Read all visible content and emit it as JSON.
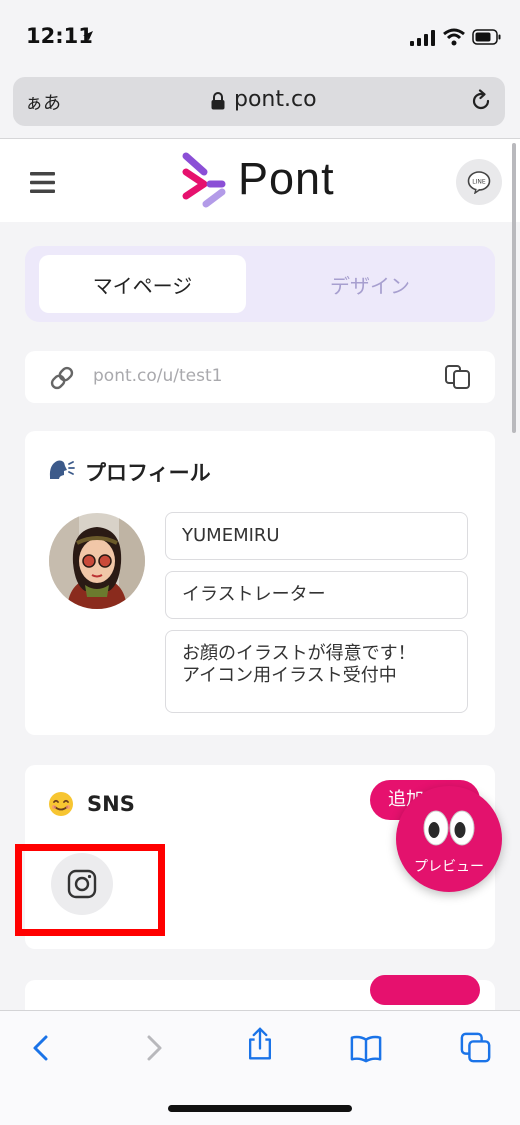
{
  "status_bar": {
    "time": "12:11"
  },
  "browser": {
    "text_size_label": "ぁあ",
    "url": "pont.co"
  },
  "header": {
    "logo_text": "Pont",
    "line_badge": "LINE"
  },
  "tabs": [
    {
      "label": "マイページ",
      "active": true
    },
    {
      "label": "デザイン",
      "active": false
    }
  ],
  "profile_link": {
    "url": "pont.co/u/test1"
  },
  "profile_section": {
    "title": "プロフィール",
    "name": "YUMEMIRU",
    "role": "イラストレーター",
    "bio": "お顔のイラストが得意です！\nアイコン用イラスト受付中"
  },
  "sns_section": {
    "title": "SNS",
    "add_label": "追加",
    "items": [
      "instagram-icon"
    ]
  },
  "preview": {
    "label": "プレビュー"
  },
  "colors": {
    "accent_pink": "#e6116e",
    "tab_bg": "#ede9fa",
    "inactive_tab_text": "#a79fcf",
    "ios_blue": "#1a73e8",
    "highlight_red": "#ff0000"
  }
}
